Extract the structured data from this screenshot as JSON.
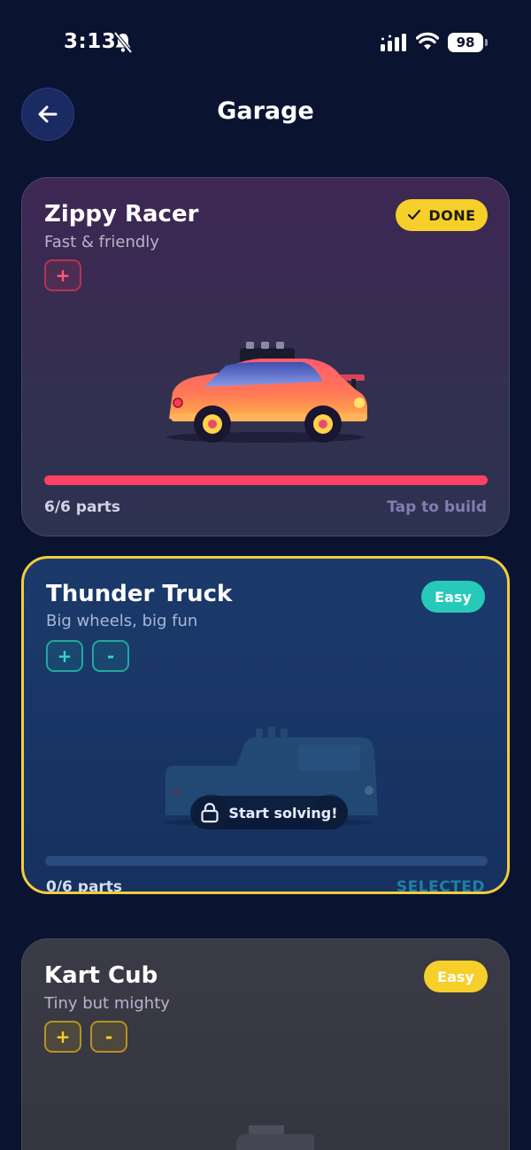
{
  "status_bar": {
    "time": "3:13",
    "battery": "98",
    "icons": [
      "bell-off-icon",
      "signal-icon",
      "wifi-icon",
      "battery-icon"
    ]
  },
  "header": {
    "title": "Garage",
    "back_icon": "arrow-left-icon"
  },
  "cars": [
    {
      "name": "Zippy Racer",
      "subtitle": "Fast & friendly",
      "badge": "DONE",
      "badge_icon": "check-icon",
      "controls": [
        "+"
      ],
      "parts": "6/6 parts",
      "progress": 1.0,
      "action": "Tap to build",
      "accent": "#ff4166"
    },
    {
      "name": "Thunder Truck",
      "subtitle": "Big wheels, big fun",
      "badge": "Easy",
      "controls": [
        "+",
        "-"
      ],
      "parts": "0/6 parts",
      "progress": 0.0,
      "lock_label": "Start solving!",
      "action": "SELECTED",
      "accent": "#27c9b8",
      "selected_border": "#f1cd3b"
    },
    {
      "name": "Kart Cub",
      "subtitle": "Tiny but mighty",
      "badge": "Easy",
      "controls": [
        "+",
        "-"
      ],
      "accent": "#f6cf2a"
    }
  ]
}
